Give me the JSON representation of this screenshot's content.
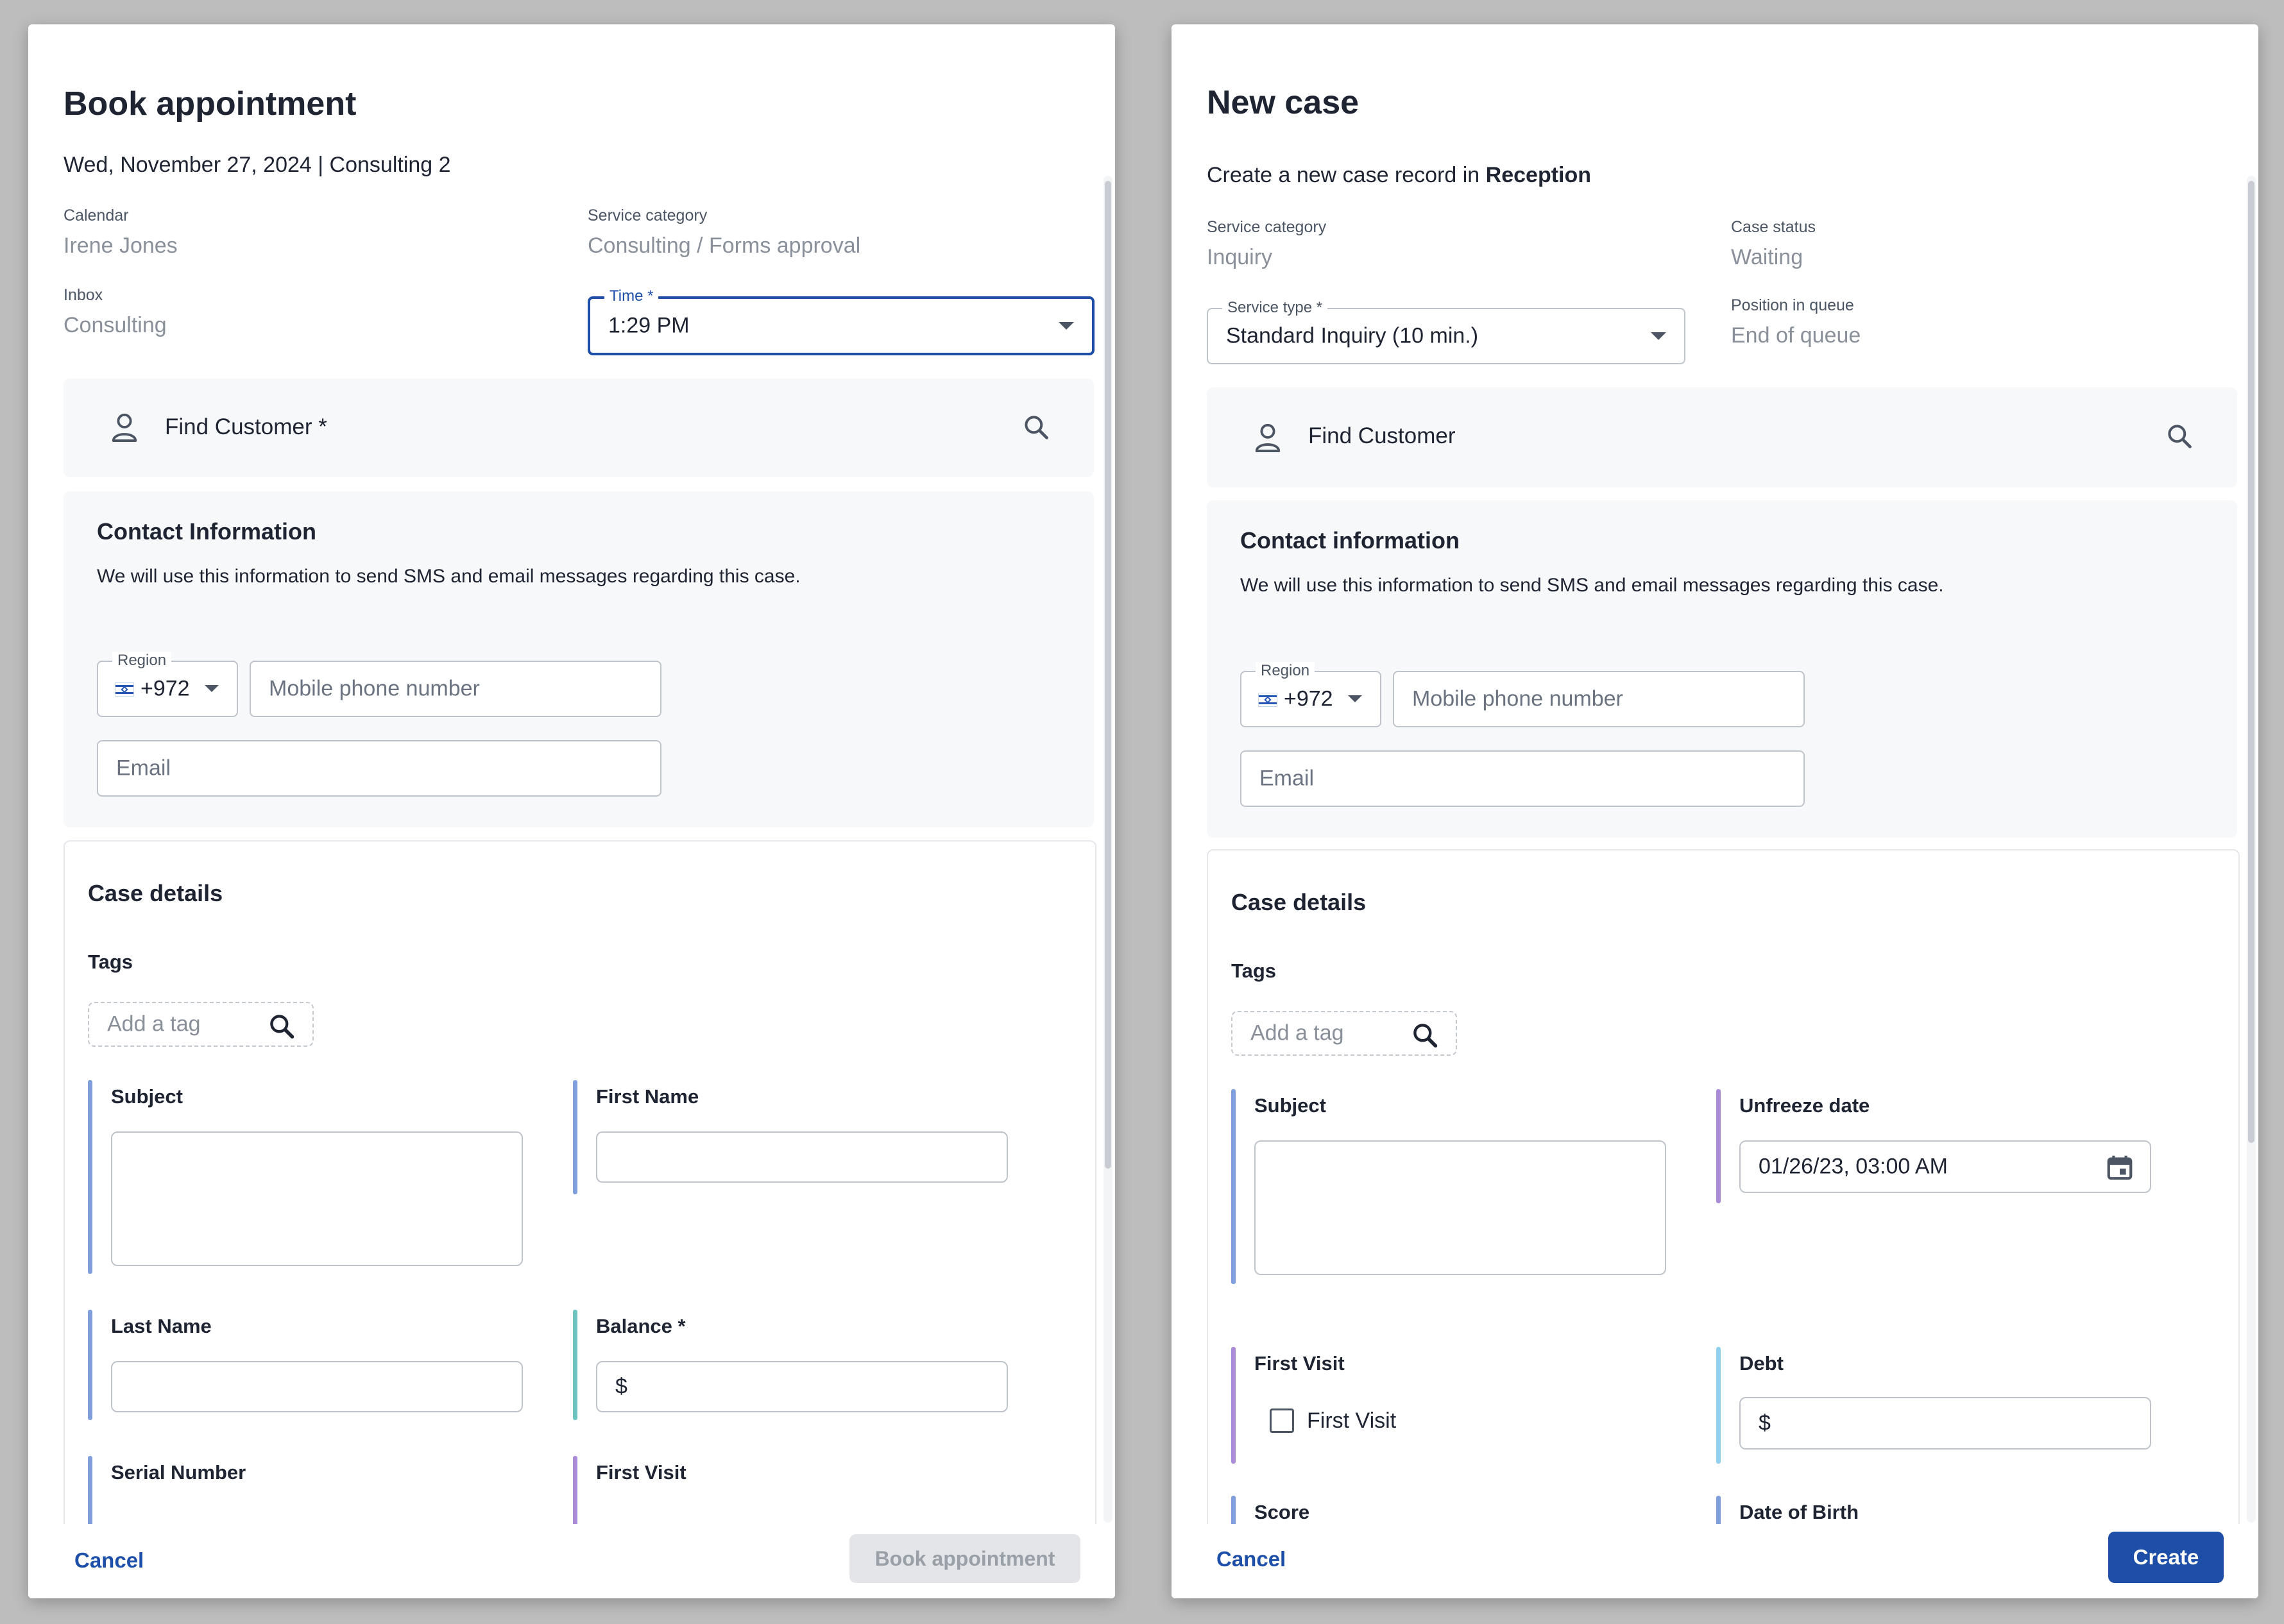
{
  "left": {
    "title": "Book appointment",
    "subtitle": "Wed, November 27, 2024 | Consulting 2",
    "calendar_label": "Calendar",
    "calendar_value": "Irene Jones",
    "service_category_label": "Service category",
    "service_category_value": "Consulting / Forms approval",
    "inbox_label": "Inbox",
    "inbox_value": "Consulting",
    "time_label": "Time *",
    "time_value": "1:29 PM",
    "find_customer": "Find Customer *",
    "contact_title": "Contact Information",
    "contact_desc": "We will use this information to send SMS and email messages regarding this case.",
    "region_label": "Region",
    "region_code": "+972",
    "phone_placeholder": "Mobile phone number",
    "email_placeholder": "Email",
    "case_details_title": "Case details",
    "tags_label": "Tags",
    "tag_placeholder": "Add a tag",
    "fields": {
      "subject": "Subject",
      "first_name": "First Name",
      "last_name": "Last Name",
      "balance": "Balance *",
      "balance_prefix": "$",
      "serial_number": "Serial Number",
      "first_visit": "First Visit"
    },
    "cancel": "Cancel",
    "submit": "Book appointment"
  },
  "right": {
    "title": "New case",
    "subtitle_prefix": "Create a new case record in ",
    "subtitle_bold": "Reception",
    "service_category_label": "Service category",
    "service_category_value": "Inquiry",
    "case_status_label": "Case status",
    "case_status_value": "Waiting",
    "service_type_label": "Service type *",
    "service_type_value": "Standard Inquiry (10 min.)",
    "position_label": "Position in queue",
    "position_value": "End of queue",
    "find_customer": "Find Customer",
    "contact_title": "Contact information",
    "contact_desc": "We will use this information to send SMS and email messages regarding this case.",
    "region_label": "Region",
    "region_code": "+972",
    "phone_placeholder": "Mobile phone number",
    "email_placeholder": "Email",
    "case_details_title": "Case details",
    "tags_label": "Tags",
    "tag_placeholder": "Add a tag",
    "fields": {
      "subject": "Subject",
      "unfreeze_date": "Unfreeze date",
      "unfreeze_value": "01/26/23, 03:00 AM",
      "first_visit": "First Visit",
      "first_visit_checkbox": "First Visit",
      "debt": "Debt",
      "debt_prefix": "$",
      "score": "Score",
      "date_of_birth": "Date of Birth"
    },
    "cancel": "Cancel",
    "submit": "Create"
  },
  "colors": {
    "accent": "#1d4fa8",
    "bar_blue": "#7f9fdc",
    "bar_teal": "#6cc3bf",
    "bar_purple": "#a98bd8",
    "bar_lightblue": "#8fd0ee"
  }
}
